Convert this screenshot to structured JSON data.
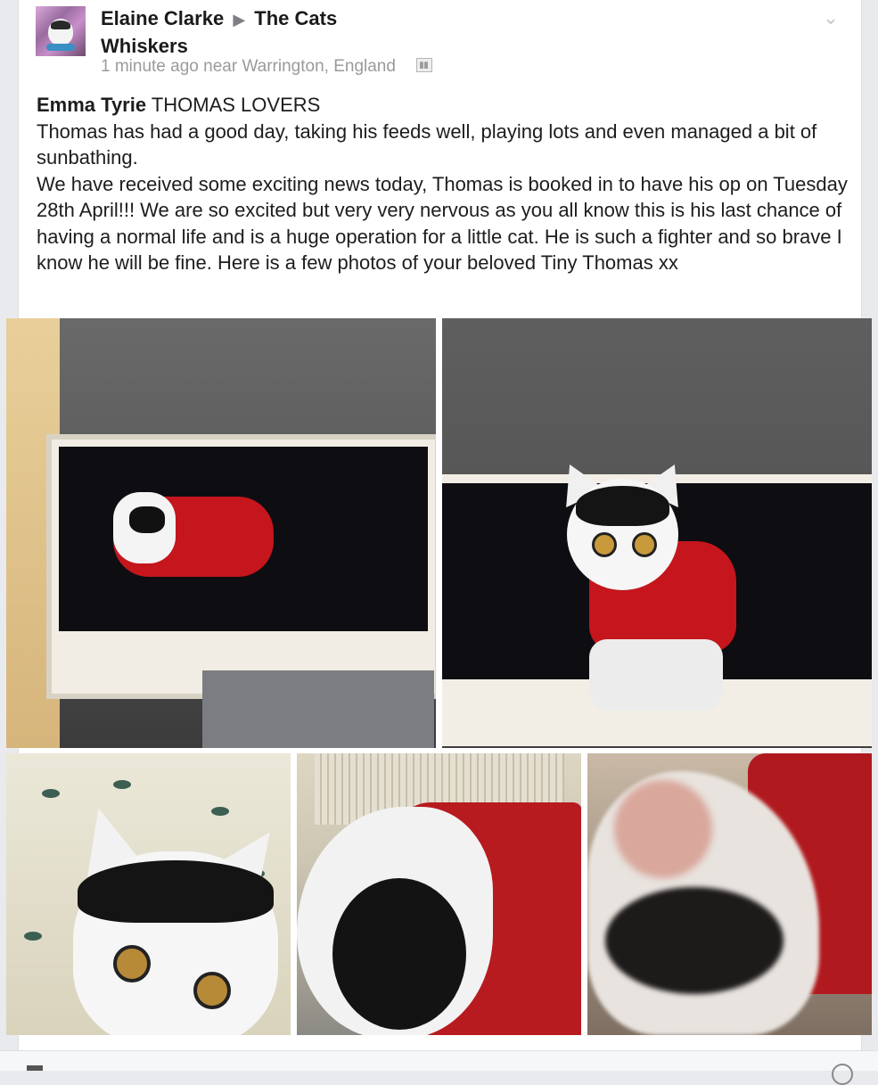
{
  "post": {
    "author": "Elaine Clarke",
    "arrow": "▶",
    "group_name_line1": "The Cats",
    "group_name_line2": "Whiskers",
    "time": "1 minute ago near Warrington, England",
    "poster_name": "Emma Tyrie",
    "poster_tag": "THOMAS LOVERS",
    "paragraph1": "Thomas has had a good day, taking his feeds well, playing lots and even managed a bit of sunbathing.",
    "paragraph2": "We have received some exciting news today, Thomas is booked in to have his op on Tuesday 28th April!!! We are so excited but very very nervous as you all know this is his last chance of having a normal life and is a huge operation for a little cat. He is such a fighter and so brave I know he will be fine. Here is a few photos of your beloved Tiny Thomas xx"
  },
  "icons": {
    "options": "chevron-down-icon",
    "audience": "friends-audience-icon"
  },
  "colors": {
    "text": "#1d1d1d",
    "meta": "#9a9a9a",
    "background": "#e9eaed",
    "card": "#ffffff",
    "cat_sweater": "#c4161c"
  }
}
